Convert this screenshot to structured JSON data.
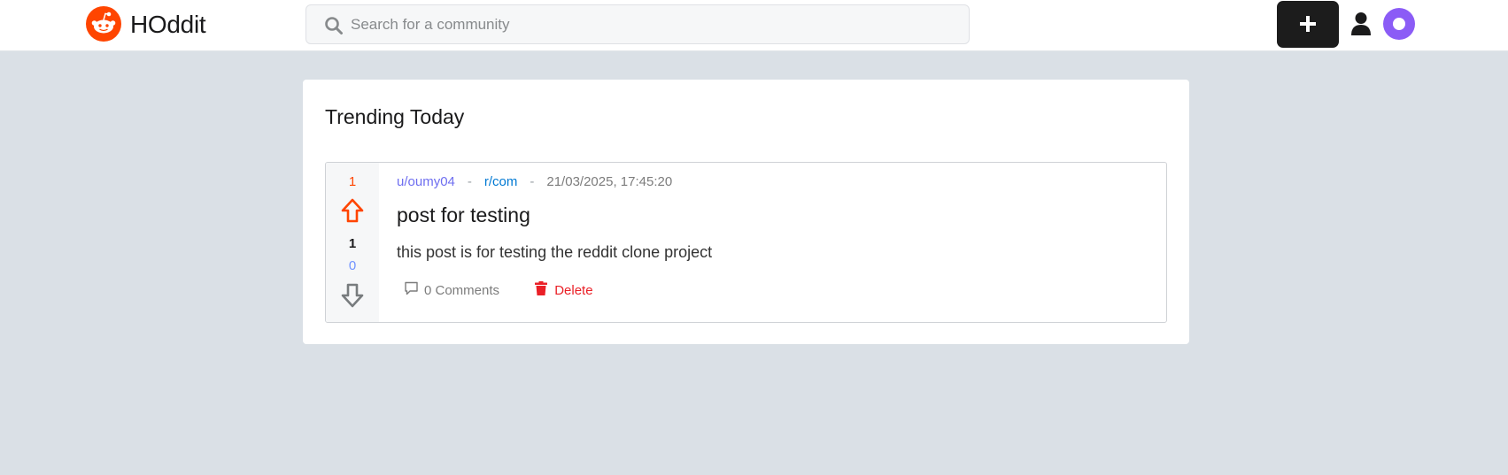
{
  "header": {
    "brand": "HOddit",
    "search_placeholder": "Search for a community",
    "create_label": "+"
  },
  "main": {
    "section_title": "Trending Today",
    "posts": [
      {
        "upvotes": "1",
        "score": "1",
        "downvotes": "0",
        "author": "u/oumy04",
        "separator": "-",
        "community": "r/com",
        "timestamp": "21/03/2025, 17:45:20",
        "title": "post for testing",
        "body": "this post is for testing the reddit clone project",
        "comments_label": "0 Comments",
        "delete_label": "Delete"
      }
    ]
  },
  "colors": {
    "brand_orange": "#ff4500",
    "page_background": "#dae0e6",
    "create_button": "#1c1c1c",
    "avatar": "#8b5cf6",
    "delete_red": "#ea2027"
  },
  "icons": [
    "reddit-alien-logo-icon",
    "search-icon",
    "plus-icon",
    "user-icon",
    "avatar-icon",
    "upvote-arrow-icon",
    "downvote-arrow-icon",
    "comment-icon",
    "trash-icon"
  ]
}
